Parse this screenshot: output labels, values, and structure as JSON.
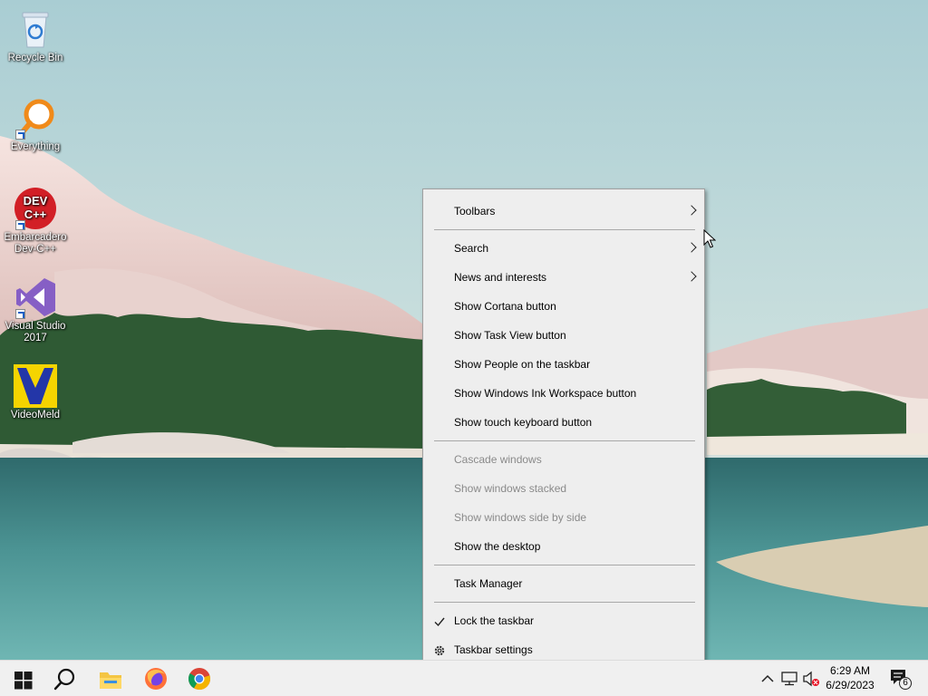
{
  "desktop": {
    "icons": [
      {
        "label": "Recycle Bin"
      },
      {
        "label": "Everything"
      },
      {
        "label": "Embarcadero Dev-C++",
        "logo_text": "DEV C++"
      },
      {
        "label": "Visual Studio 2017"
      },
      {
        "label": "VideoMeld"
      }
    ]
  },
  "context_menu": {
    "toolbars": "Toolbars",
    "search": "Search",
    "news": "News and interests",
    "cortana": "Show Cortana button",
    "task_view": "Show Task View button",
    "people": "Show People on the taskbar",
    "ink": "Show Windows Ink Workspace button",
    "touch_kb": "Show touch keyboard button",
    "cascade": "Cascade windows",
    "stacked": "Show windows stacked",
    "side_by_side": "Show windows side by side",
    "desktop": "Show the desktop",
    "task_manager": "Task Manager",
    "lock": "Lock the taskbar",
    "settings": "Taskbar settings",
    "lock_checked": true
  },
  "taskbar": {
    "icons": [
      "windows-logo-icon",
      "search-icon",
      "file-explorer-icon",
      "firefox-icon",
      "chrome-icon"
    ],
    "tray_icons": [
      "chevron-up-icon",
      "network-icon",
      "volume-muted-icon"
    ],
    "clock_time": "6:29 AM",
    "clock_date": "6/29/2023",
    "notification_count": "6"
  },
  "colors": {
    "menu_bg": "#eeeeee",
    "taskbar_bg": "#f0f0f0",
    "disabled_text": "#8a8a8a"
  }
}
